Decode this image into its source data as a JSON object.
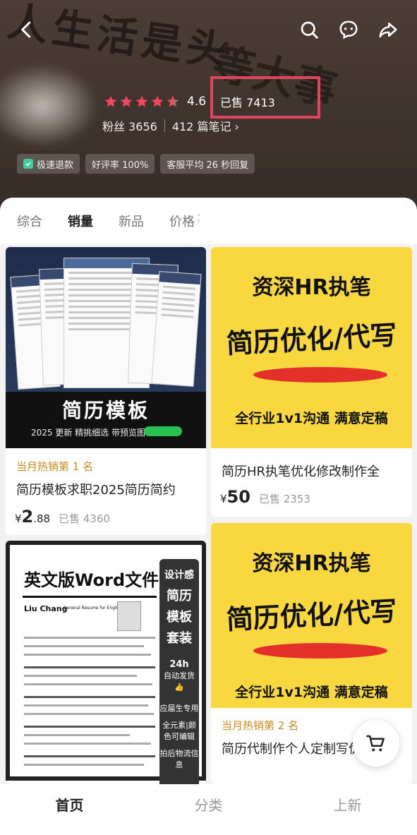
{
  "header": {
    "rating": "4.6",
    "sold": "已售 7413",
    "fans": "粉丝 3656",
    "notes": "412 篇笔记",
    "badges": [
      "极速退款",
      "好评率 100%",
      "客服平均 26 秒回复"
    ],
    "bg_text_1": "人生活是头",
    "bg_text_2": "等大事"
  },
  "sort_tabs": [
    "综合",
    "销量",
    "新品",
    "价格"
  ],
  "products": [
    {
      "image_title": "简历模板",
      "image_sub": "2025 更新 精挑细选 带预览图",
      "tag": "当月热销第 1 名",
      "title": "简历模板求职2025简历简约",
      "currency": "¥",
      "price_int": "2",
      "price_dec": ".88",
      "sold": "已售 4360"
    },
    {
      "image_line1": "资深HR执笔",
      "image_line2": "简历优化/代写",
      "image_line3": "全行业1v1沟通  满意定稿",
      "title": "简历HR执笔优化修改制作全",
      "currency": "¥",
      "price_int": "50",
      "sold": "已售 2353"
    },
    {
      "image_title": "英文版Word文件",
      "image_side": [
        "设计感",
        "简历",
        "模板",
        "套装"
      ],
      "image_side_small": [
        "24h",
        "自动发货",
        "应届生专用",
        "全元素|颜色可编辑",
        "拍后物流信息"
      ],
      "eng_name": "Liu Chang",
      "eng_sub": "General Resume for English Majors"
    },
    {
      "image_line1": "资深HR执笔",
      "image_line2": "简历优化/代写",
      "image_line3": "全行业1v1沟通  满意定稿",
      "tag": "当月热销第 2 名",
      "title": "简历代制作个人定制写优化"
    }
  ],
  "bottom_nav": [
    "首页",
    "分类",
    "上新"
  ],
  "colors": {
    "highlight": "#e0455c",
    "tag": "#c98b1a",
    "yellow": "#f8d83e"
  }
}
